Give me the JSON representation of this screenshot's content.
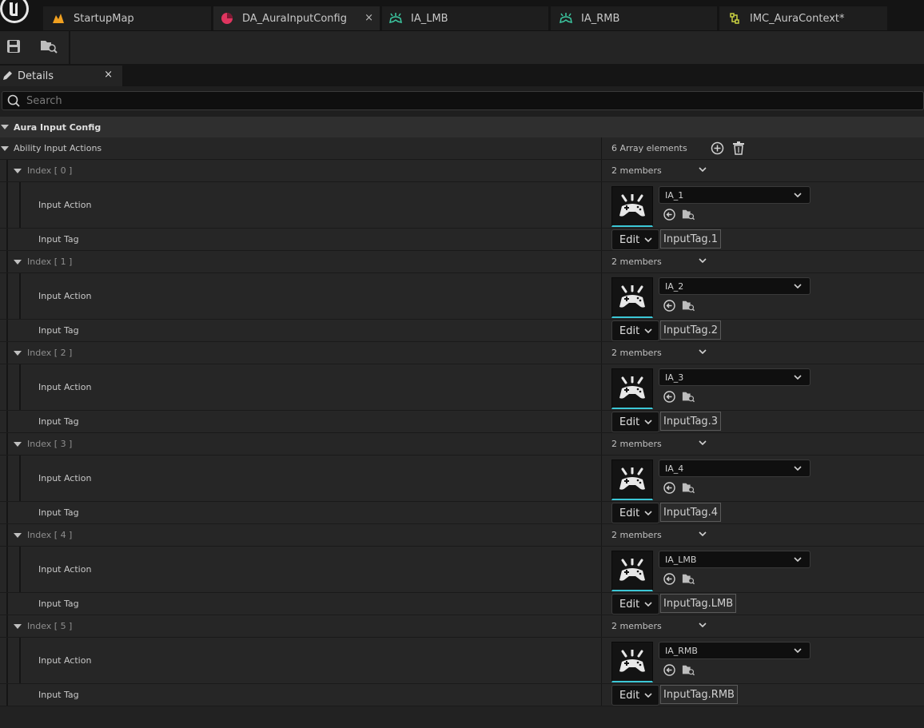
{
  "tabs": [
    {
      "label": "StartupMap",
      "icon": "map-icon"
    },
    {
      "label": "DA_AuraInputConfig",
      "icon": "data-asset-icon"
    },
    {
      "label": "IA_LMB",
      "icon": "input-action-icon"
    },
    {
      "label": "IA_RMB",
      "icon": "input-action-icon"
    },
    {
      "label": "IMC_AuraContext*",
      "icon": "mapping-context-icon"
    }
  ],
  "details": {
    "title": "Details",
    "close": "×"
  },
  "search": {
    "placeholder": "Search"
  },
  "category": {
    "label": "Aura Input Config"
  },
  "array": {
    "label": "Ability Input Actions",
    "count": "6 Array elements"
  },
  "labels": {
    "input_action": "Input Action",
    "input_tag": "Input Tag",
    "edit": "Edit"
  },
  "entries": [
    {
      "index": "Index [ 0 ]",
      "members": "2 members",
      "action": "IA_1",
      "tag": "InputTag.1"
    },
    {
      "index": "Index [ 1 ]",
      "members": "2 members",
      "action": "IA_2",
      "tag": "InputTag.2"
    },
    {
      "index": "Index [ 2 ]",
      "members": "2 members",
      "action": "IA_3",
      "tag": "InputTag.3"
    },
    {
      "index": "Index [ 3 ]",
      "members": "2 members",
      "action": "IA_4",
      "tag": "InputTag.4"
    },
    {
      "index": "Index [ 4 ]",
      "members": "2 members",
      "action": "IA_LMB",
      "tag": "InputTag.LMB"
    },
    {
      "index": "Index [ 5 ]",
      "members": "2 members",
      "action": "IA_RMB",
      "tag": "InputTag.RMB"
    }
  ],
  "colors": {
    "accent_cyan": "#3cc7d6",
    "map_icon": "#f0a020",
    "data_asset": "#e0355f",
    "input_action": "#3cc7a0",
    "mapping_context": "#c8d040"
  }
}
